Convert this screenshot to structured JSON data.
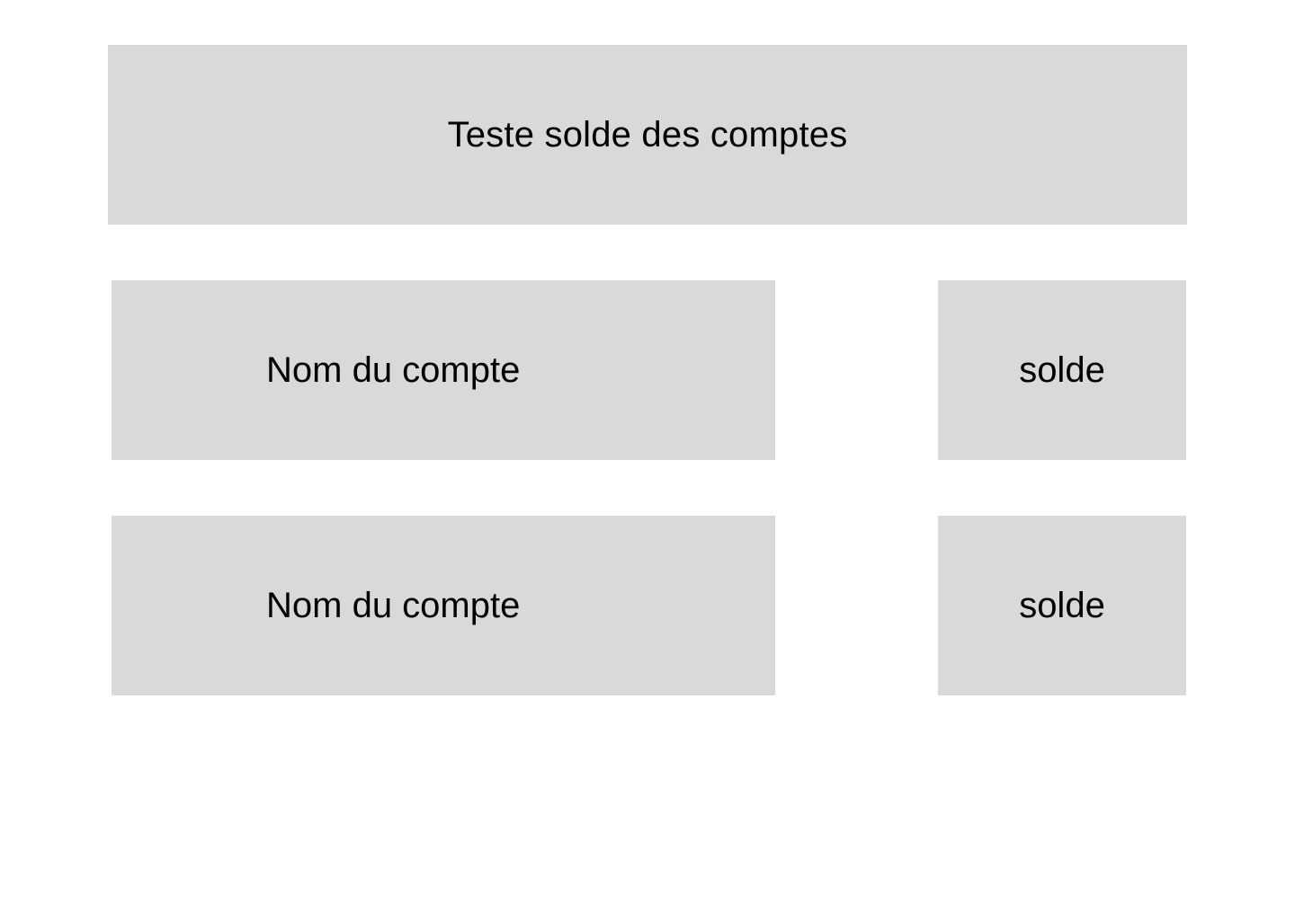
{
  "header": {
    "title": "Teste solde des comptes"
  },
  "accounts": [
    {
      "name": "Nom du compte",
      "balance": "solde"
    },
    {
      "name": "Nom du compte",
      "balance": "solde"
    }
  ],
  "colors": {
    "box_background": "#d9d9d9",
    "page_background": "#ffffff",
    "text": "#000000"
  }
}
